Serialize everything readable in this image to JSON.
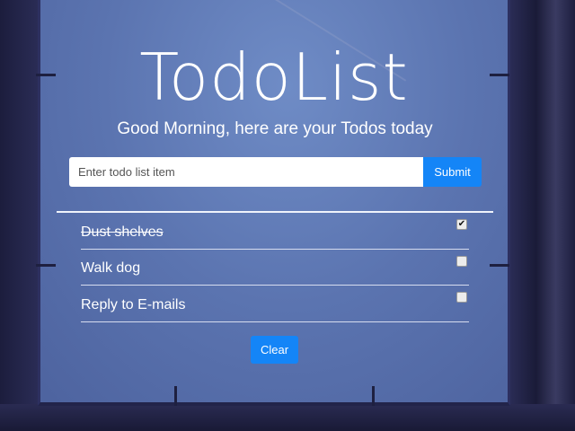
{
  "header": {
    "title": "TodoList",
    "subtitle": "Good Morning, here are your Todos today"
  },
  "form": {
    "placeholder": "Enter todo list item",
    "submit_label": "Submit"
  },
  "todos": [
    {
      "text": "Dust shelves",
      "done": true,
      "check": "✔"
    },
    {
      "text": "Walk dog",
      "done": false,
      "check": ""
    },
    {
      "text": "Reply to E-mails",
      "done": false,
      "check": ""
    }
  ],
  "clear_label": "Clear",
  "colors": {
    "accent": "#1485f7",
    "background": "#5b74b0",
    "frame": "#1c1d3d"
  }
}
